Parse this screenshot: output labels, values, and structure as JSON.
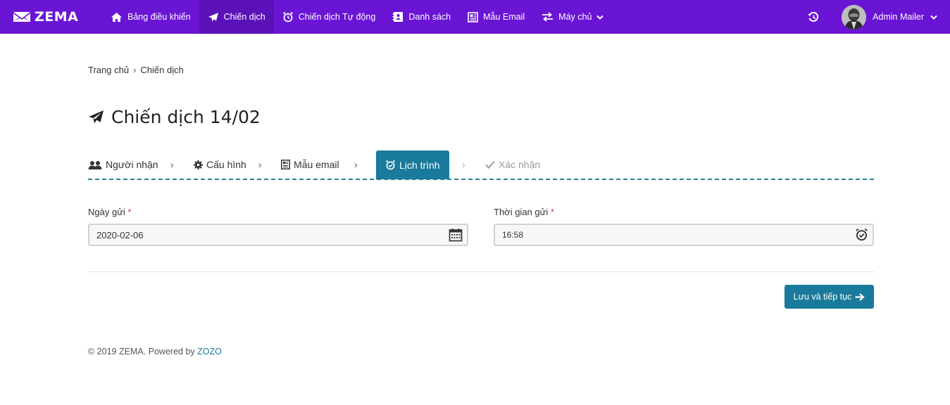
{
  "brand": {
    "name": "ZEMA"
  },
  "nav": {
    "items": [
      {
        "label": "Bảng điều khiển",
        "icon": "home-icon"
      },
      {
        "label": "Chiến dịch",
        "icon": "paper-plane-icon",
        "active": true
      },
      {
        "label": "Chiến dịch Tự động",
        "icon": "alarm-clock-icon"
      },
      {
        "label": "Danh sách",
        "icon": "contact-book-icon"
      },
      {
        "label": "Mẫu Email",
        "icon": "newspaper-icon"
      },
      {
        "label": "Máy chủ",
        "icon": "exchange-icon",
        "dropdown": true
      }
    ]
  },
  "user": {
    "name": "Admin Mailer"
  },
  "breadcrumb": {
    "home": "Trang chủ",
    "sep": "›",
    "current": "Chiến dịch"
  },
  "page": {
    "title": "Chiến dịch 14/02"
  },
  "steps": [
    {
      "label": "Người nhận",
      "icon": "users-icon"
    },
    {
      "label": "Cấu hình",
      "icon": "gear-icon"
    },
    {
      "label": "Mẫu email",
      "icon": "newspaper-icon"
    },
    {
      "label": "Lịch trình",
      "icon": "alarm-clock-icon",
      "active": true
    },
    {
      "label": "Xác nhận",
      "icon": "check-icon",
      "disabled": true
    }
  ],
  "step_sep": "›",
  "form": {
    "date_label": "Ngày gửi",
    "date_value": "2020-02-06",
    "time_label": "Thời gian gửi",
    "time_value": "16:58",
    "required_mark": "*"
  },
  "actions": {
    "save_continue": "Lưu và tiếp tục"
  },
  "footer": {
    "text": "© 2019 ZEMA. Powered by",
    "link": "ZOZO"
  },
  "colors": {
    "navbar": "#6a14d4",
    "accent": "#1a7a9b",
    "required": "#dd3333"
  }
}
